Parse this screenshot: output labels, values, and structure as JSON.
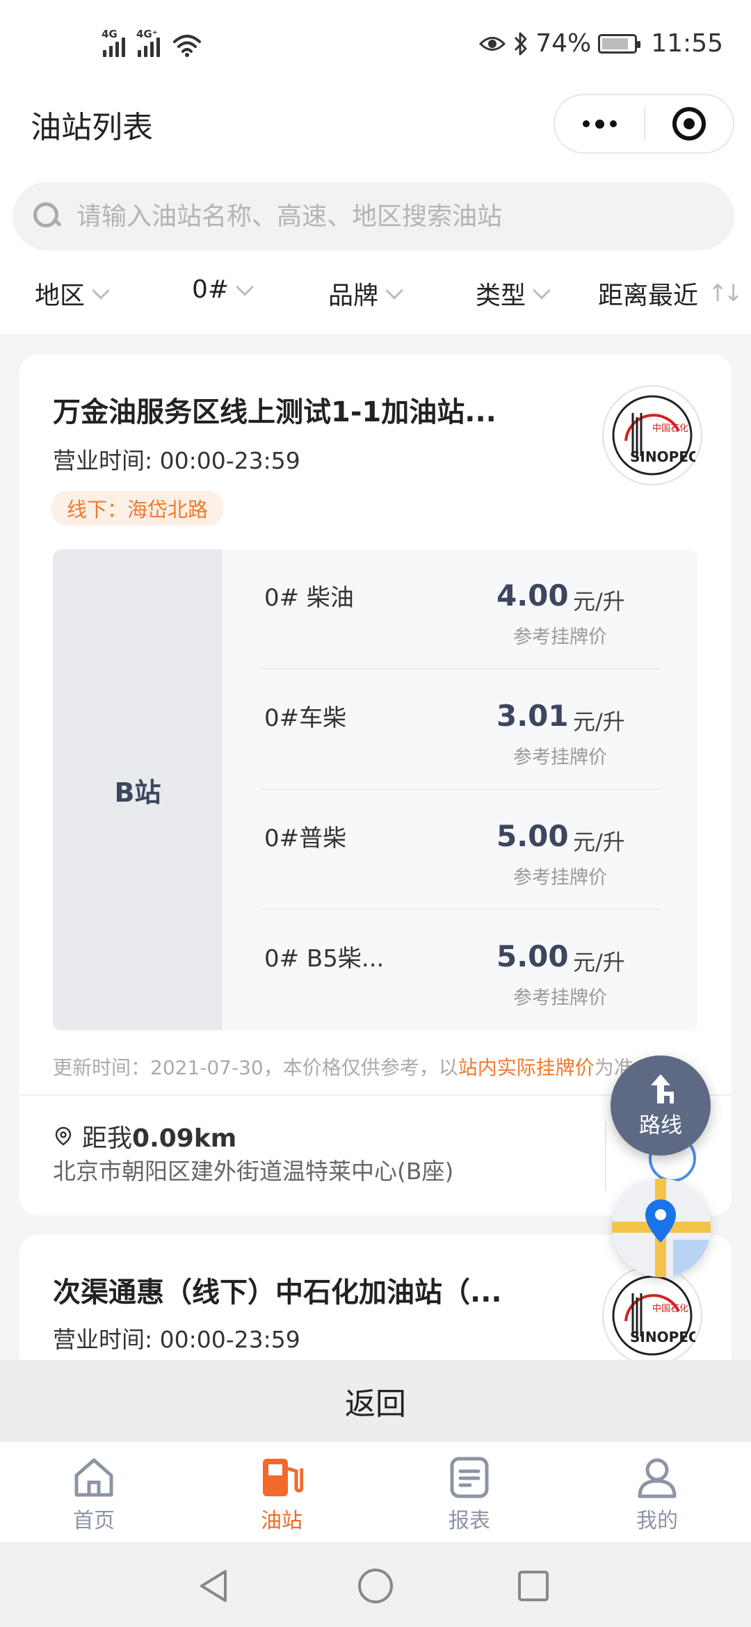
{
  "status_bar": {
    "sim1_label": "4G",
    "sim2_label": "4G⁺",
    "battery_percent": "74%",
    "battery_level": 0.74,
    "time": "11:55"
  },
  "header": {
    "title": "油站列表"
  },
  "search": {
    "placeholder": "请输入油站名称、高速、地区搜索油站"
  },
  "filters": [
    {
      "label": "地区"
    },
    {
      "label": "0#"
    },
    {
      "label": "品牌"
    },
    {
      "label": "类型"
    },
    {
      "label": "距离最近"
    }
  ],
  "stations": [
    {
      "name": "万金油服务区线上测试1-1加油站...",
      "hours": "营业时间: 00:00-23:59",
      "tag": "线下：海岱北路",
      "brand_logo_text": "中国石化 SINOPEC",
      "sub_station": "B站",
      "prices": [
        {
          "fuel": "0# 柴油",
          "price": "4.00",
          "unit": "元/升",
          "ref": "参考挂牌价"
        },
        {
          "fuel": "0#车柴",
          "price": "3.01",
          "unit": "元/升",
          "ref": "参考挂牌价"
        },
        {
          "fuel": "0#普柴",
          "price": "5.00",
          "unit": "元/升",
          "ref": "参考挂牌价"
        },
        {
          "fuel": "0# B5柴...",
          "price": "5.00",
          "unit": "元/升",
          "ref": "参考挂牌价"
        }
      ],
      "update_prefix": "更新时间：2021-07-30，本价格仅供参考，以",
      "update_highlight": "站内实际挂牌价",
      "update_suffix": "为准",
      "distance_label": "距我",
      "distance_value": "0.09km",
      "address": "北京市朝阳区建外街道温特莱中心(B座)"
    },
    {
      "name": "次渠通惠（线下）中石化加油站（...",
      "hours": "营业时间: 00:00-23:59",
      "brand_logo_text": "中国石化 SINOPEC"
    }
  ],
  "fab": {
    "route_label": "路线"
  },
  "back_button": "返回",
  "tabbar": [
    {
      "label": "首页",
      "icon": "home-icon",
      "active": false
    },
    {
      "label": "油站",
      "icon": "gas-station-icon",
      "active": true
    },
    {
      "label": "报表",
      "icon": "report-icon",
      "active": false
    },
    {
      "label": "我的",
      "icon": "profile-icon",
      "active": false
    }
  ],
  "colors": {
    "accent_orange": "#f2692a",
    "tag_orange": "#ef7a2d",
    "price_navy": "#3c4660",
    "fab_gray_blue": "#5e6984",
    "inactive_tab": "#8c94a4"
  }
}
